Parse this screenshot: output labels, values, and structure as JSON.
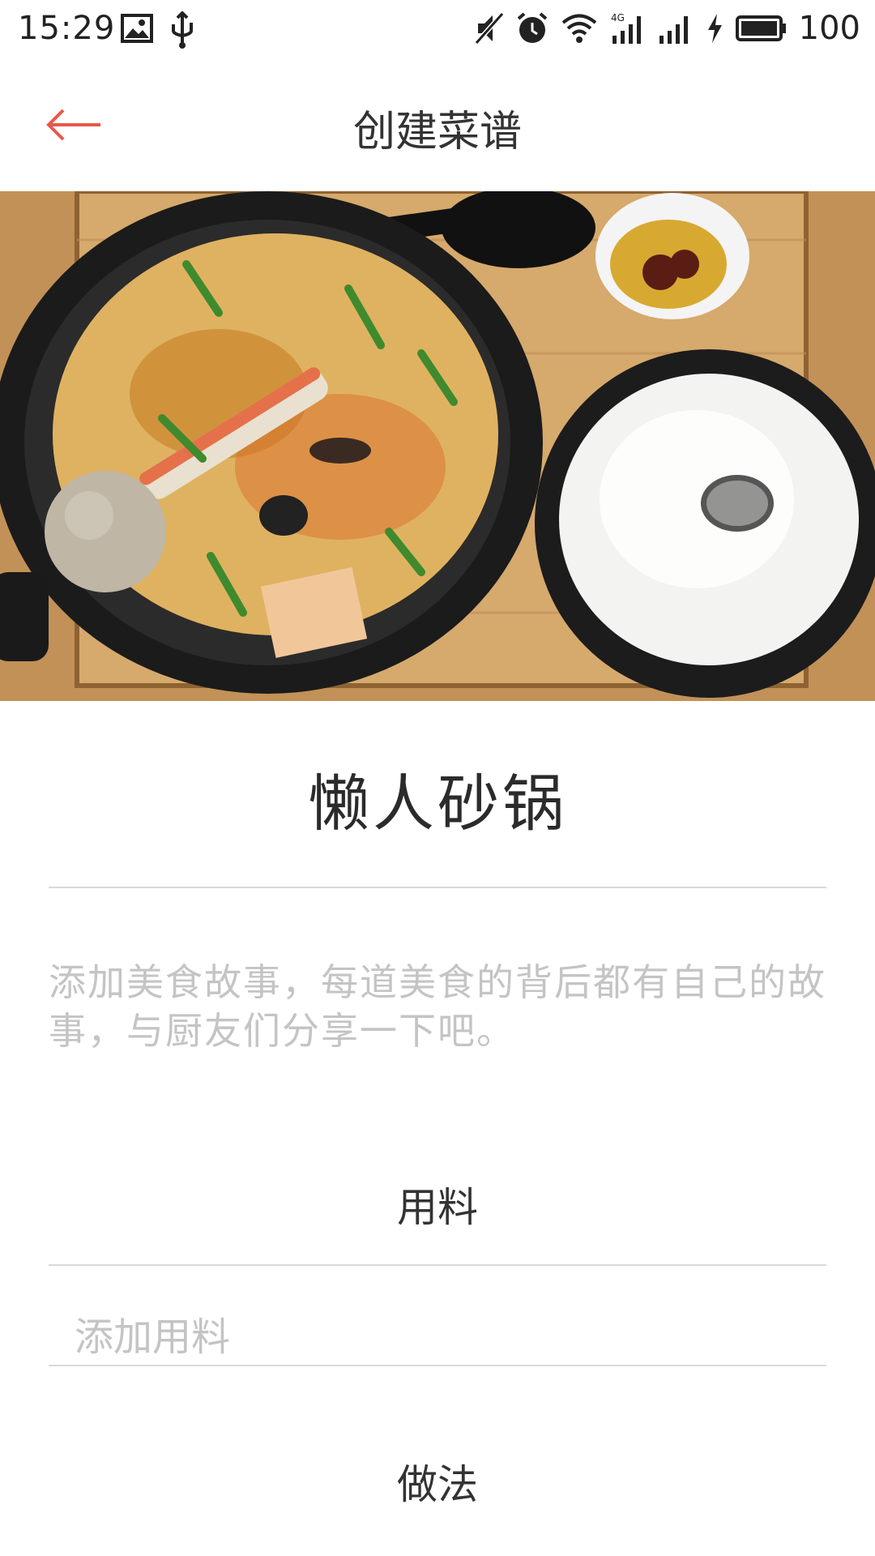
{
  "status_bar": {
    "time": "15:29",
    "battery": "100",
    "icons": [
      "image-icon",
      "usb-icon",
      "mute-icon",
      "alarm-icon",
      "wifi-icon",
      "4g-signal-icon",
      "signal-icon",
      "charging-icon",
      "battery-icon"
    ],
    "network_label": "4G"
  },
  "app_bar": {
    "title": "创建菜谱",
    "back_icon": "arrow-left-icon",
    "accent_color": "#e8584a"
  },
  "cover_photo": {
    "description_icon": "food-photo"
  },
  "recipe": {
    "name": "懒人砂锅",
    "story_placeholder": "添加美食故事，每道美食的背后都有自己的故事，与厨友们分享一下吧。"
  },
  "ingredients": {
    "title": "用料",
    "add_placeholder": "添加用料"
  },
  "method": {
    "title": "做法"
  }
}
